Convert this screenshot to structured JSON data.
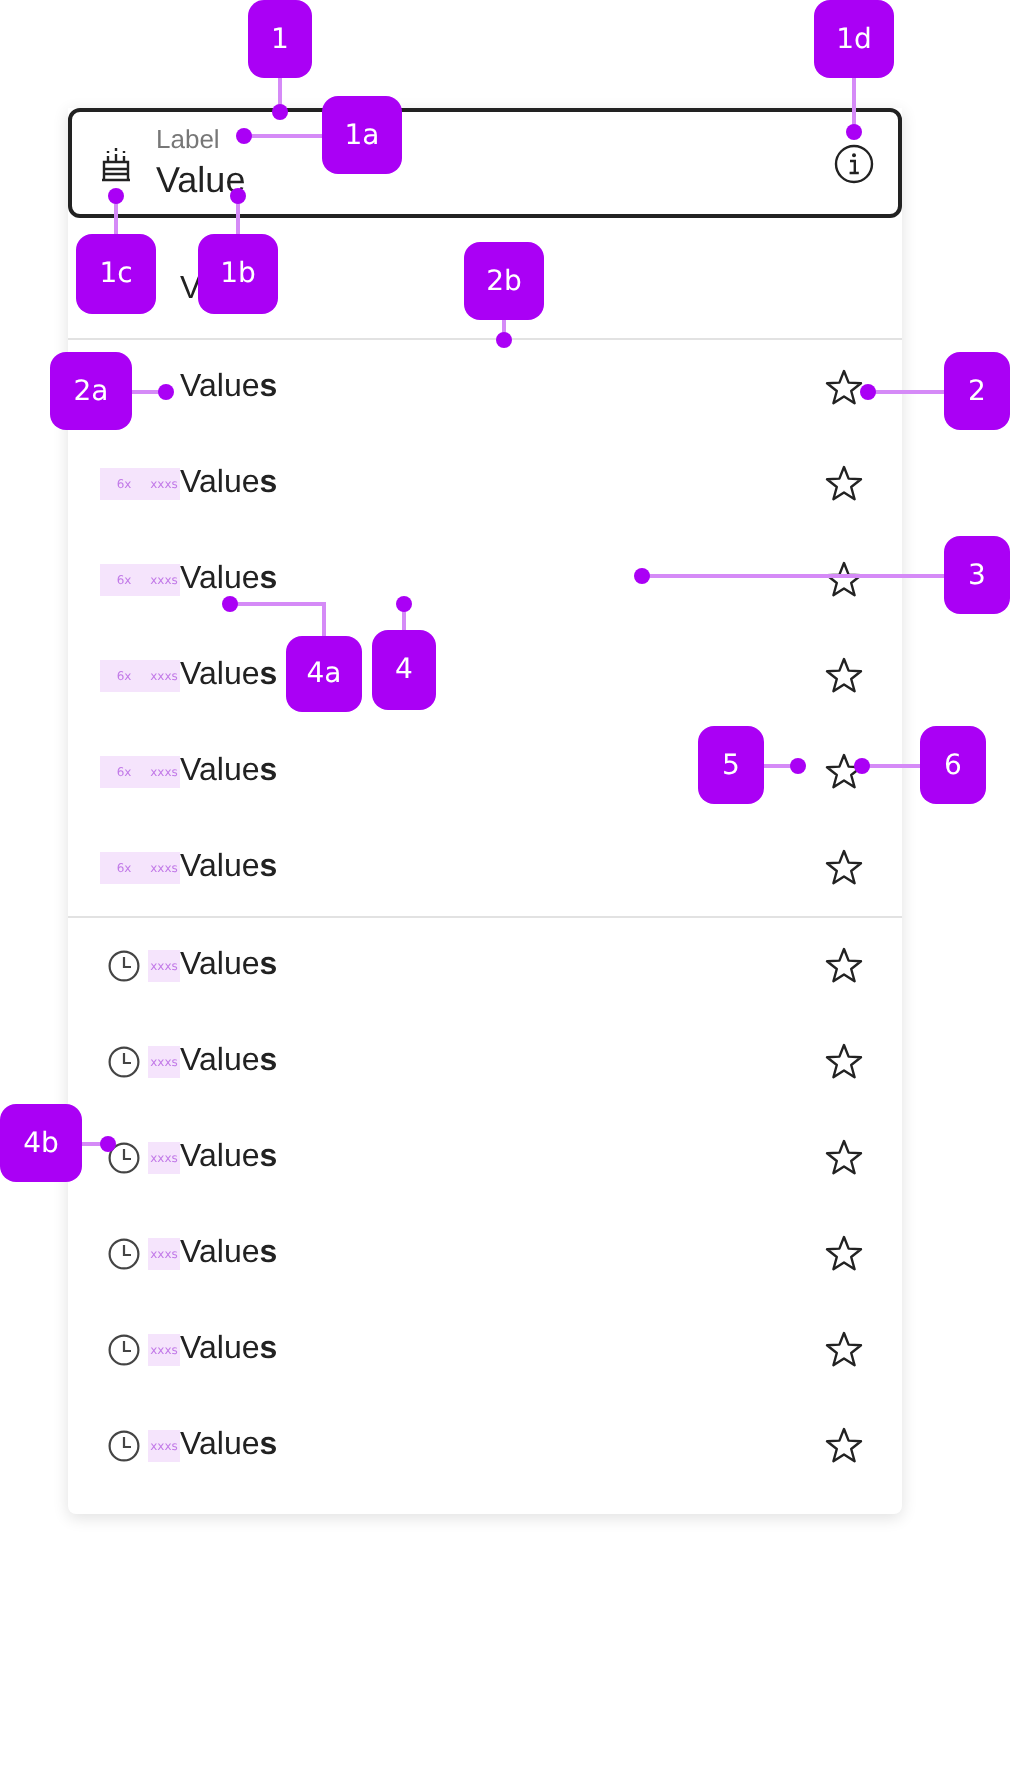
{
  "field": {
    "label": "Label",
    "value": "Value"
  },
  "top_row": {
    "label": "V"
  },
  "sections": [
    {
      "rows": [
        {
          "kind": "tag",
          "tags": [],
          "label": "Value**s**"
        },
        {
          "kind": "tag",
          "tags": [
            "6x",
            "xxxs"
          ],
          "label": "Value**s**"
        },
        {
          "kind": "tag",
          "tags": [
            "6x",
            "xxxs"
          ],
          "label": "Value**s**"
        },
        {
          "kind": "tag",
          "tags": [
            "6x",
            "xxxs"
          ],
          "label": "Value**s**"
        },
        {
          "kind": "tag",
          "tags": [
            "6x",
            "xxxs"
          ],
          "label": "Value**s**"
        },
        {
          "kind": "tag",
          "tags": [
            "6x",
            "xxxs"
          ],
          "label": "Value**s**"
        }
      ]
    },
    {
      "rows": [
        {
          "kind": "clock",
          "tags": [
            "xxxs"
          ],
          "label": "Value**s**"
        },
        {
          "kind": "clock",
          "tags": [
            "xxxs"
          ],
          "label": "Value**s**"
        },
        {
          "kind": "clock",
          "tags": [
            "xxxs"
          ],
          "label": "Value**s**"
        },
        {
          "kind": "clock",
          "tags": [
            "xxxs"
          ],
          "label": "Value**s**"
        },
        {
          "kind": "clock",
          "tags": [
            "xxxs"
          ],
          "label": "Value**s**"
        },
        {
          "kind": "clock",
          "tags": [
            "xxxs"
          ],
          "label": "Value**s**"
        }
      ]
    }
  ],
  "annotations": [
    {
      "label": "1"
    },
    {
      "label": "1d"
    },
    {
      "label": "1a"
    },
    {
      "label": "1c"
    },
    {
      "label": "1b"
    },
    {
      "label": "2b"
    },
    {
      "label": "2a"
    },
    {
      "label": "2"
    },
    {
      "label": "3"
    },
    {
      "label": "4a"
    },
    {
      "label": "4"
    },
    {
      "label": "5"
    },
    {
      "label": "6"
    },
    {
      "label": "4b"
    }
  ]
}
